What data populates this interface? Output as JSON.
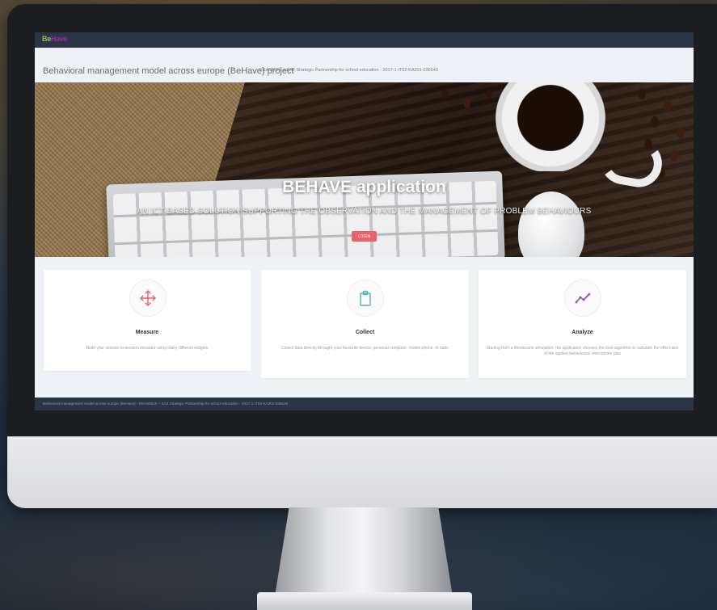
{
  "app": {
    "logo_be": "Be",
    "logo_have": "Have"
  },
  "header": {
    "project_title": "Behavioral management model across europe (BeHave) project",
    "project_subtitle": "ERASMUS + KA2 Strategic Partnership for school education - 2017-1-IT02-KA201-036540"
  },
  "hero": {
    "title": "BEHAVE application",
    "subtitle": "AN ICT-BASED SOLUTION SUPPORTING THE OBSERVATION AND THE MANAGEMENT OF PROBLEM BEHAVIOURS",
    "login_label": "LOGIN"
  },
  "features": [
    {
      "icon": "move-arrows-icon",
      "title": "Measure",
      "description": "Build your session-to-session measure using many different widgets"
    },
    {
      "icon": "clipboard-icon",
      "title": "Collect",
      "description": "Collect data directly throught your favourite device: personal computer, mobile phone, or table"
    },
    {
      "icon": "trend-line-icon",
      "title": "Analyze",
      "description": "Starting from a Montecarlo simulation, the application chooses the best algorithm to calculate the effect size of the applied behavioural intervention plan"
    }
  ],
  "footer": {
    "text": "Behavioral management model across europe (BeHave) - ERASMUS + KA2 Strategic Partnership for school education - 2017-1-IT02-KA201-036540"
  },
  "colors": {
    "navbar": "#2a3544",
    "login_button": "#e8636b",
    "measure_icon": "#e8636b",
    "collect_icon": "#4db6ac",
    "analyze_icon": "#8e44ad",
    "logo_green": "#8bc34a",
    "logo_purple": "#9c27b0"
  }
}
